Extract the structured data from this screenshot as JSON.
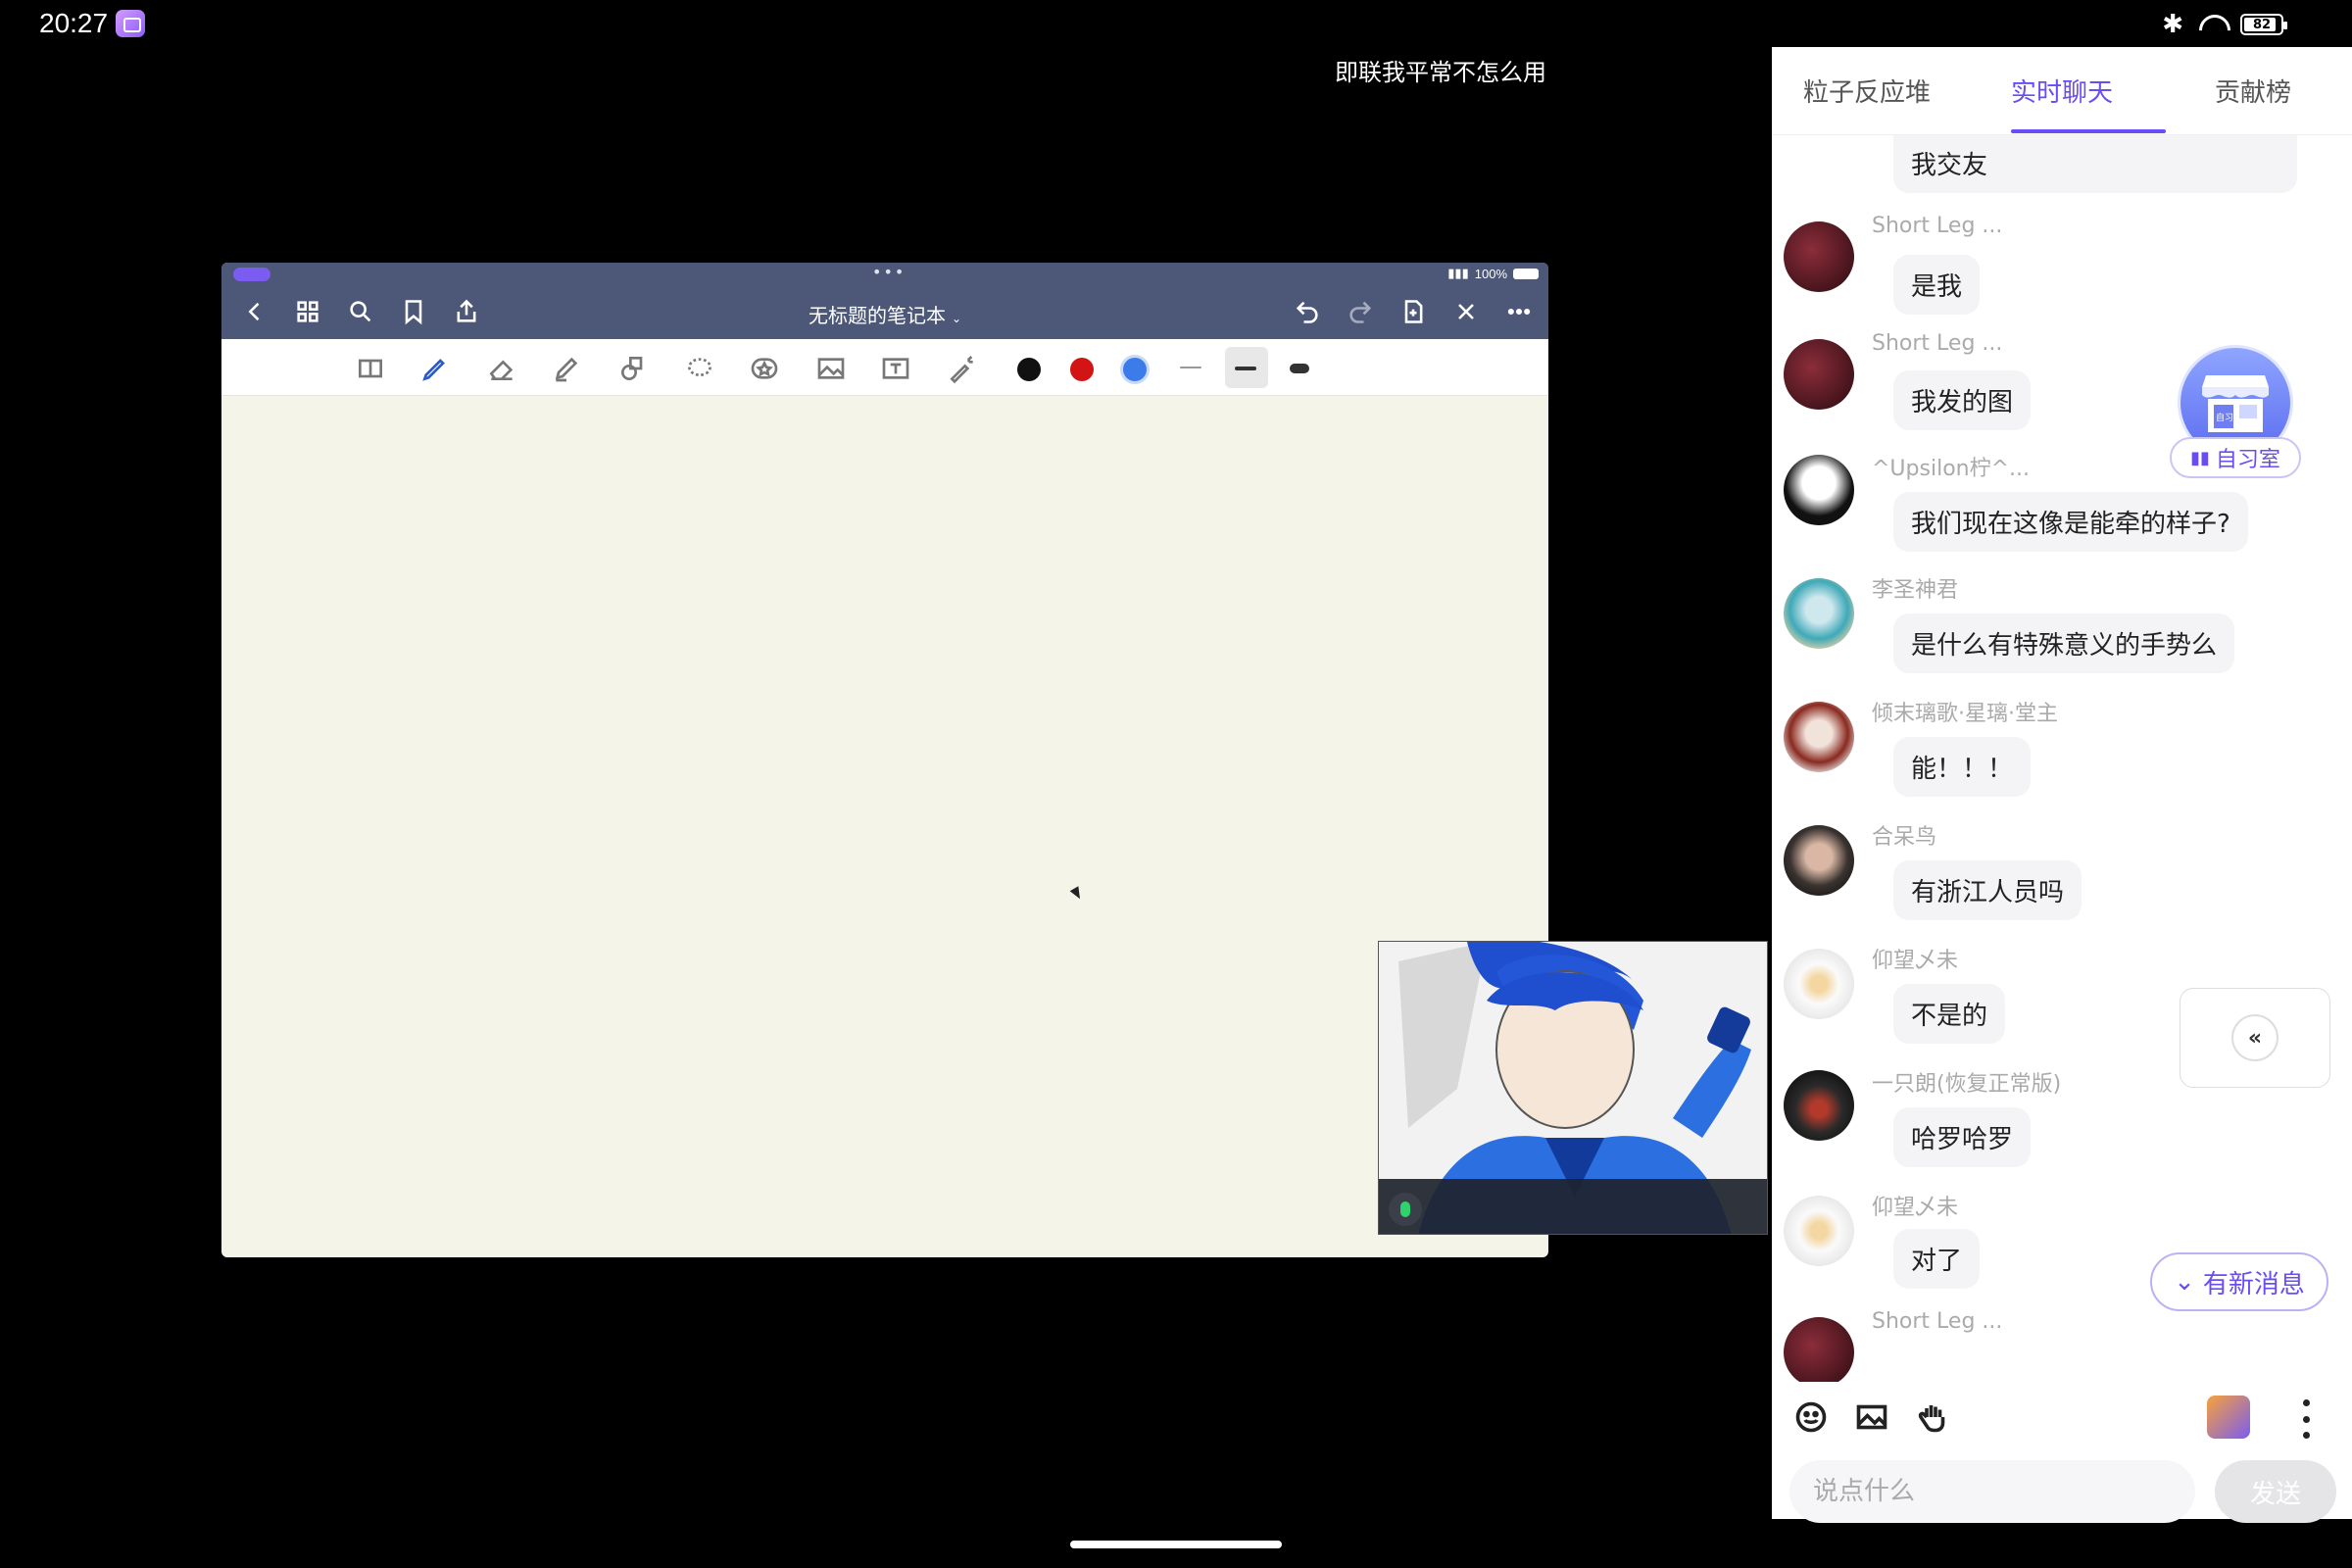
{
  "status_bar": {
    "time": "20:27",
    "battery": "82"
  },
  "room_title": "即联我平常不怎么用",
  "ipad": {
    "battery": "100%",
    "doc_title": "无标题的笔记本",
    "colors": [
      "#111111",
      "#d31414",
      "#3b7bea"
    ]
  },
  "tabs": [
    {
      "label": "粒子反应堆"
    },
    {
      "label": "实时聊天"
    },
    {
      "label": "贡献榜"
    }
  ],
  "messages": [
    {
      "user": "",
      "text": "我交友"
    },
    {
      "user": "Short Leg ...",
      "text": "是我"
    },
    {
      "user": "Short Leg ...",
      "text": "我发的图"
    },
    {
      "user": "^Upsilon柠^...",
      "text": "我们现在这像是能牵的样子?"
    },
    {
      "user": "李圣神君",
      "text": "是什么有特殊意义的手势么"
    },
    {
      "user": "倾末璃歌·星璃·堂主",
      "text": "能！！！"
    },
    {
      "user": "合呆鸟",
      "text": "有浙江人员吗"
    },
    {
      "user": "仰望乄未",
      "text": "不是的"
    },
    {
      "user": "一只朗(恢复正常版)",
      "text": "哈罗哈罗"
    },
    {
      "user": "仰望乄未",
      "text": "对了"
    },
    {
      "user": "Short Leg ...",
      "text": ""
    }
  ],
  "study_room": {
    "label": "自习室",
    "badge": "自习"
  },
  "new_messages": "有新消息",
  "input": {
    "placeholder": "说点什么",
    "send": "发送"
  }
}
